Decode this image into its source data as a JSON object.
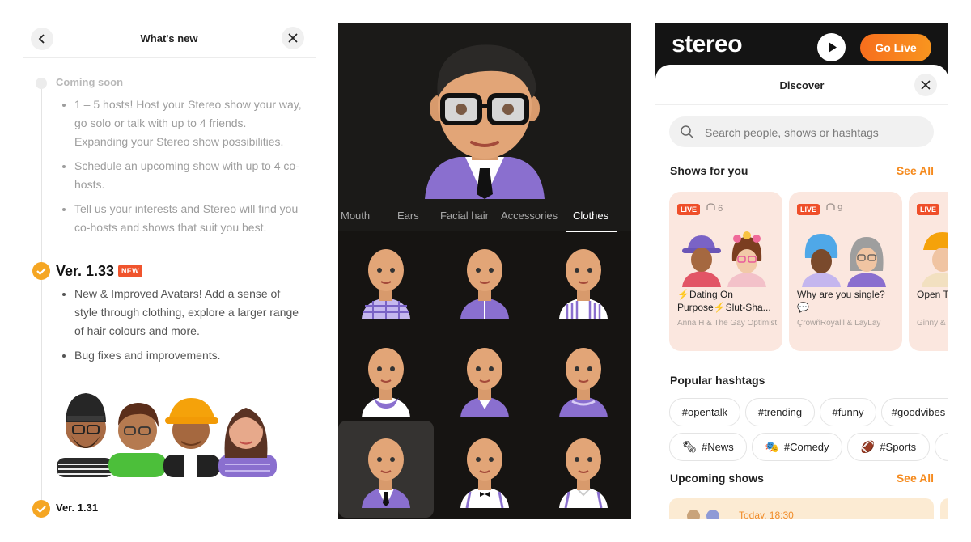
{
  "whats_new": {
    "title": "What's new",
    "coming_soon_label": "Coming soon",
    "coming_soon_items": [
      "1 – 5 hosts! Host your Stereo show your way, go solo or talk with up to 4 friends. Expanding your Stereo show possibilities.",
      "Schedule an upcoming show with up to 4 co-hosts.",
      "Tell us your interests and Stereo will find you co-hosts and shows that suit you best."
    ],
    "version_current": "Ver. 1.33",
    "new_badge": "NEW",
    "version_current_items": [
      "New & Improved Avatars! Add a sense of style through clothing, explore a larger range of hair colours and more.",
      "Bug fixes and improvements."
    ],
    "version_previous": "Ver. 1.31"
  },
  "avatar_editor": {
    "tabs": [
      "Mouth",
      "Ears",
      "Facial hair",
      "Accessories",
      "Clothes"
    ],
    "active_tab": "Clothes",
    "selected_outfit_index": 6
  },
  "discover": {
    "logo": "stereo",
    "go_live_label": "Go Live",
    "title": "Discover",
    "search_placeholder": "Search people, shows or hashtags",
    "shows_for_you_label": "Shows for you",
    "see_all_label": "See All",
    "shows": [
      {
        "live": "LIVE",
        "listeners": "6",
        "title": "⚡Dating On Purpose⚡Slut-Sha...",
        "hosts": "Anna H & The Gay Optimist"
      },
      {
        "live": "LIVE",
        "listeners": "9",
        "title": "Why are you single? 💬",
        "hosts": "ÇrowñRoyalll & LayLay"
      },
      {
        "live": "LIVE",
        "listeners": "",
        "title": "Open T",
        "hosts": "Ginny & "
      }
    ],
    "popular_hashtags_label": "Popular hashtags",
    "hashtags_row1": [
      "#opentalk",
      "#trending",
      "#funny",
      "#goodvibes"
    ],
    "hashtags_row2": [
      "#News",
      "#Comedy",
      "#Sports"
    ],
    "upcoming_shows_label": "Upcoming shows",
    "upcoming_see_all_label": "See All",
    "upcoming_time": "Today, 18:30"
  },
  "colors": {
    "accent_orange": "#f58a1d",
    "live_red": "#ef4f2a",
    "check_yellow": "#f5a623",
    "avatar_purple": "#8a6fcf"
  }
}
